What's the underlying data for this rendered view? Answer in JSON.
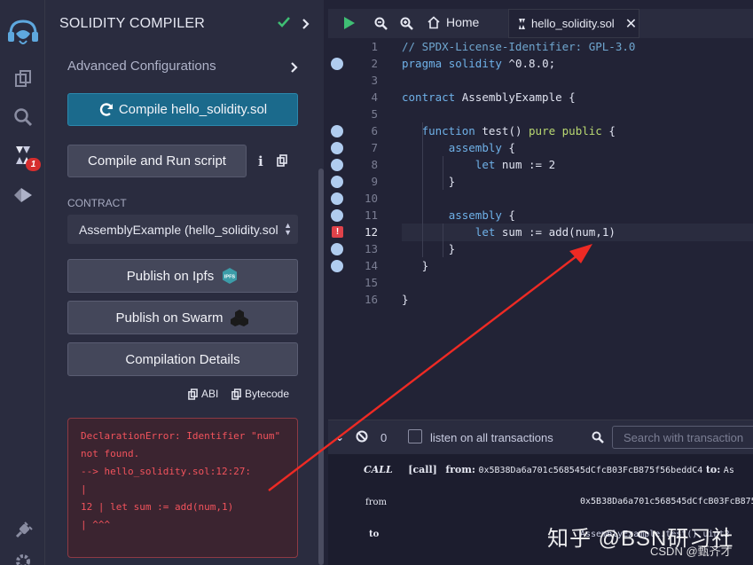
{
  "panel": {
    "title": "SOLIDITY COMPILER",
    "advanced": "Advanced Configurations",
    "compile_button": "Compile hello_solidity.sol",
    "compile_run_button": "Compile and Run script",
    "info_glyph": "i",
    "contract_label": "CONTRACT",
    "contract_selected": "AssemblyExample (hello_solidity.sol",
    "publish_ipfs": "Publish on Ipfs",
    "ipfs_badge": "IPFS",
    "publish_swarm": "Publish on Swarm",
    "compilation_details": "Compilation Details",
    "abi_link": "ABI",
    "bytecode_link": "Bytecode",
    "error_lines": [
      "DeclarationError: Identifier \"num\"",
      "not found.",
      "--> hello_solidity.sol:12:27:",
      "|",
      "12 | let sum := add(num,1)",
      "| ^^^"
    ]
  },
  "iconbar": {
    "badge_count": "1"
  },
  "tabs": {
    "home": "Home",
    "file": "hello_solidity.sol"
  },
  "editor": {
    "active_line": 12,
    "line_numbers": [
      "1",
      "2",
      "3",
      "4",
      "5",
      "6",
      "7",
      "8",
      "9",
      "10",
      "11",
      "12",
      "13",
      "14",
      "15",
      "16"
    ],
    "lines": [
      "// SPDX-License-Identifier: GPL-3.0",
      "pragma solidity ^0.8.0;",
      "",
      "contract AssemblyExample {",
      "",
      "   function test() pure public {",
      "       assembly {",
      "           let num := 2",
      "       }",
      "",
      "       assembly {",
      "           let sum := add(num,1)",
      "       }",
      "   }",
      "",
      "}"
    ]
  },
  "terminal": {
    "count": "0",
    "listen_label": "listen on all transactions",
    "search_placeholder": "Search with transaction",
    "call_tag": "CALL",
    "call_text": "[call]",
    "from_label": "from:",
    "from_addr": "0x5B38Da6a701c568545dCfcB03FcB875f56beddC4",
    "to_label": "to:",
    "to_addr_partial": "As",
    "row_from": "from",
    "row_from_value": "0x5B38Da6a701c568545dCfcB03FcB875",
    "row_to": "to",
    "row_to_value": "AssemblyExample.test() uint2"
  },
  "watermark": {
    "main": "知乎 @BSN研习社",
    "sub": "CSDN @甄齐才"
  },
  "colors": {
    "accent": "#1b6a8c",
    "error": "#f2535c",
    "arrow": "#ee2a24",
    "background": "#222336"
  }
}
